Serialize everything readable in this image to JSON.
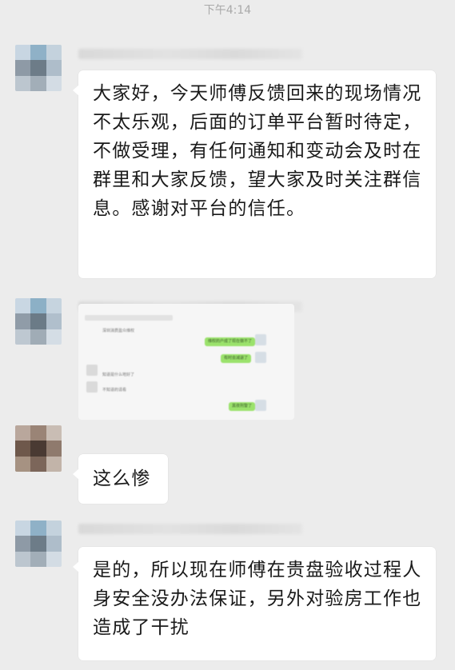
{
  "status_time": "下午4:14",
  "messages": [
    {
      "type": "text",
      "text": "大家好，今天师傅反馈回来的现场情况不太乐观，后面的订单平台暂时待定，不做受理，有任何通知和变动会及时在群里和大家反馈，望大家及时关注群信息。感谢对平台的信任。"
    },
    {
      "type": "image",
      "embedded_chat": {
        "left_1": "深圳消费盈众维权",
        "right_1": "维权的户成了现在做不了",
        "right_2": "有时会减退了",
        "left_2": "知道是什么地好了",
        "left_3": "不知道的请看",
        "right_3": "黑夜刑警了"
      }
    },
    {
      "type": "text",
      "text": "这么惨"
    },
    {
      "type": "text",
      "text": "是的，所以现在师傅在贵盘验收过程人身安全没办法保证，另外对验房工作也造成了干扰"
    }
  ],
  "colors": {
    "background": "#ececec",
    "bubble": "#ffffff",
    "green_bubble": "#9be26c",
    "time_text": "#a9a9a9"
  }
}
